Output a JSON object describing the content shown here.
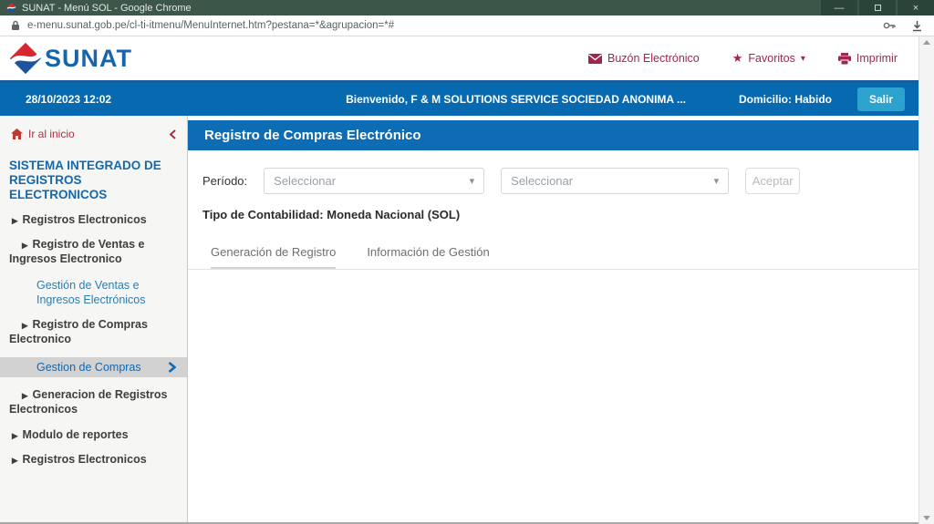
{
  "browser": {
    "title": "SUNAT - Menú SOL - Google Chrome",
    "url": "e-menu.sunat.gob.pe/cl-ti-itmenu/MenuInternet.htm?pestana=*&agrupacion=*#",
    "controls": {
      "minimize": "—",
      "close": "×"
    }
  },
  "header": {
    "logo": "SUNAT",
    "buzon": "Buzón Electrónico",
    "favoritos": "Favoritos",
    "imprimir": "Imprimir"
  },
  "infobar": {
    "datetime": "28/10/2023 12:02",
    "welcome": "Bienvenido, F & M SOLUTIONS SERVICE SOCIEDAD ANONIMA ...",
    "domicilio": "Domicilio: Habido",
    "salir": "Salir"
  },
  "sidebar": {
    "home": "Ir al inicio",
    "title": "SISTEMA INTEGRADO DE REGISTROS ELECTRONICOS",
    "items": [
      {
        "label": "Registros Electronicos"
      },
      {
        "label": "Registro de Ventas e Ingresos Electronico"
      },
      {
        "label": "Gestión de Ventas e Ingresos Electrónicos"
      },
      {
        "label": "Registro de Compras Electronico"
      },
      {
        "label": "Gestion de Compras"
      },
      {
        "label": "Generacion de Registros Electronicos"
      },
      {
        "label": "Modulo de reportes"
      },
      {
        "label": "Registros Electronicos"
      }
    ]
  },
  "main": {
    "title": "Registro de Compras Electrónico",
    "periodo_label": "Período:",
    "select1": {
      "placeholder": "Seleccionar"
    },
    "select2": {
      "placeholder": "Seleccionar"
    },
    "aceptar": "Aceptar",
    "tipo_contabilidad": "Tipo de Contabilidad: Moneda Nacional (SOL)",
    "tabs": [
      {
        "label": "Generación de Registro"
      },
      {
        "label": "Información de Gestión"
      }
    ]
  },
  "icons": {
    "star": "★",
    "caret_down": "▾",
    "bullet": "▶"
  },
  "colors": {
    "titlebar_green": "#3c564a",
    "accent_blue": "#0769b0",
    "content_bar_blue": "#0e6cb4",
    "crimson": "#a0274a",
    "salir_cyan": "#2ca3cf",
    "selected_gray": "#d2d2d2",
    "logo_blue": "#1566ac",
    "logo_red": "#d7282f"
  }
}
